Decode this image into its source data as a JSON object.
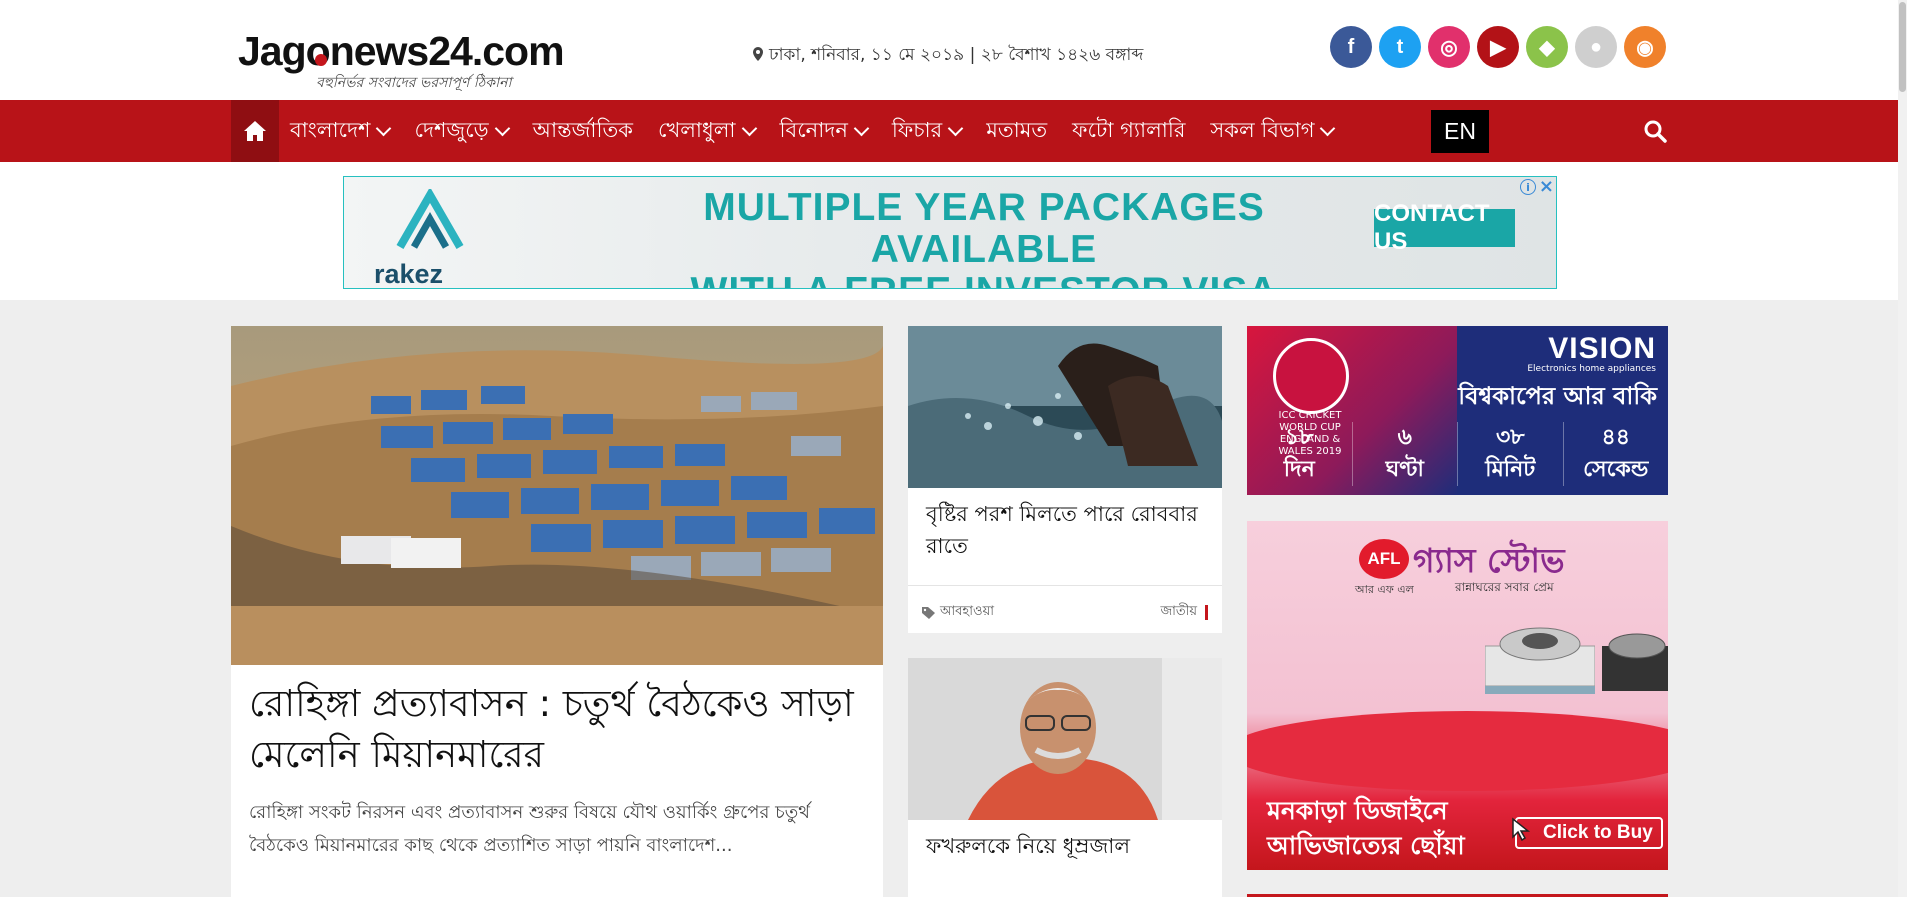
{
  "site": {
    "logo_text": "Jagonews24.com",
    "tagline": "বহুনির্ভর সংবাদের ভরসাপূর্ণ ঠিকানা"
  },
  "dateline": "ঢাকা, শনিবার, ১১ মে ২০১৯ | ২৮ বৈশাখ ১৪২৬ বঙ্গাব্দ",
  "social": [
    {
      "name": "facebook-icon",
      "glyph": "f",
      "color": "#3b5998"
    },
    {
      "name": "twitter-icon",
      "glyph": "t",
      "color": "#1da1f2"
    },
    {
      "name": "instagram-icon",
      "glyph": "◎",
      "color": "#e1306c"
    },
    {
      "name": "youtube-icon",
      "glyph": "▶",
      "color": "#b31217"
    },
    {
      "name": "android-icon",
      "glyph": "◆",
      "color": "#8bc34a"
    },
    {
      "name": "apple-icon",
      "glyph": "●",
      "color": "#cfcfcf"
    },
    {
      "name": "rss-icon",
      "glyph": "◉",
      "color": "#f0812b"
    }
  ],
  "nav": {
    "items": [
      {
        "label": "বাংলাদেশ",
        "dropdown": true
      },
      {
        "label": "দেশজুড়ে",
        "dropdown": true
      },
      {
        "label": "আন্তর্জাতিক",
        "dropdown": false
      },
      {
        "label": "খেলাধুলা",
        "dropdown": true
      },
      {
        "label": "বিনোদন",
        "dropdown": true
      },
      {
        "label": "ফিচার",
        "dropdown": true
      },
      {
        "label": "মতামত",
        "dropdown": false
      },
      {
        "label": "ফটো গ্যালারি",
        "dropdown": false
      },
      {
        "label": "সকল বিভাগ",
        "dropdown": true
      }
    ],
    "lang": "EN"
  },
  "top_ad": {
    "brand": "rakez",
    "headline_1": "MULTIPLE YEAR PACKAGES AVAILABLE",
    "headline_2": "WITH A FREE INVESTOR VISA",
    "cta": "CONTACT US"
  },
  "lead": {
    "title": "রোহিঙ্গা প্রত্যাবাসন : চতুর্থ বৈঠকেও সাড়া মেলেনি মিয়ানমারের",
    "summary": "রোহিঙ্গা সংকট নিরসন এবং প্রত্যাবাসন শুরুর বিষয়ে যৌথ ওয়ার্কিং গ্রুপের চতুর্থ বৈঠকেও মিয়ানমারের কাছ থেকে প্রত্যাশিত সাড়া পায়নি বাংলাদেশ..."
  },
  "cards": [
    {
      "title": "বৃষ্টির পরশ মিলতে পারে রোববার রাতে",
      "tag": "আবহাওয়া",
      "category": "জাতীয়"
    },
    {
      "title": "ফখরুলকে নিয়ে ধূম্রজাল"
    }
  ],
  "worldcup_ad": {
    "brand": "VISION",
    "brand_sub": "Electronics home appliances",
    "heading": "বিশ্বকাপের আর বাকি",
    "cup_text": "ICC CRICKET WORLD CUP ENGLAND & WALES 2019",
    "countdown": [
      {
        "value": "১৮",
        "unit": "দিন"
      },
      {
        "value": "৬",
        "unit": "ঘণ্টা"
      },
      {
        "value": "৩৮",
        "unit": "মিনিট"
      },
      {
        "value": "৪৪",
        "unit": "সেকেন্ড"
      }
    ]
  },
  "afl_ad": {
    "logo": "AFL",
    "brand": "গ্যাস স্টোভ",
    "sub_left": "আর এফ এল",
    "sub_right": "রান্নাঘরের সবার প্রেম",
    "line_1": "মনকাড়া ডিজাইনে",
    "line_2": "আভিজাত্যের ছোঁয়া",
    "cta": "Click to Buy"
  }
}
